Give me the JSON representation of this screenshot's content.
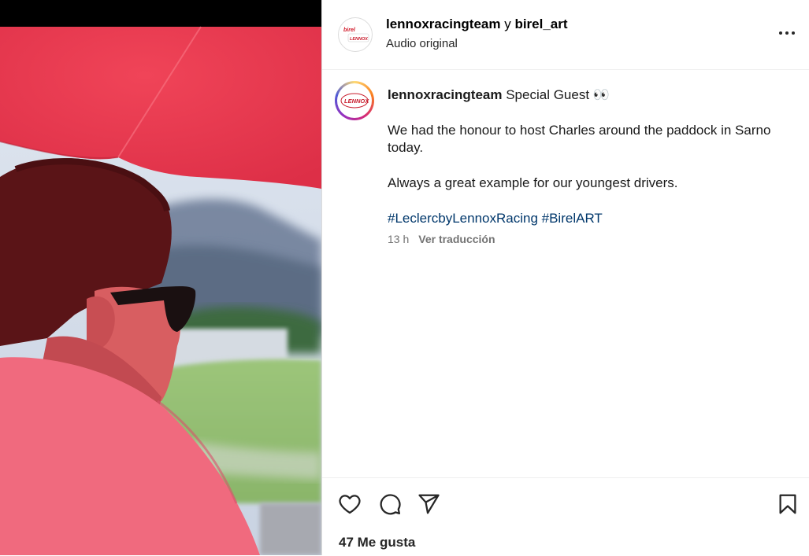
{
  "header": {
    "account_1": "lennoxracingteam",
    "joiner": " y ",
    "account_2": "birel_art",
    "subtitle": "Audio original",
    "more_icon": "more-horizontal-icon"
  },
  "caption": {
    "username": "lennoxracingteam",
    "first_line": " Special Guest 👀",
    "paragraph_1": "We had the honour to host Charles around the paddock in Sarno today.",
    "paragraph_2": "Always a great example for our youngest drivers.",
    "hashtag_1": "#LeclercbyLennoxRacing",
    "hashtag_2": "#BirelART",
    "time_ago": "13 h",
    "translate_label": "Ver traducción"
  },
  "avatars": {
    "collab_text_1": "birel",
    "collab_text_2": "LENNOX",
    "profile_text": "LENNOX"
  },
  "actions": {
    "like_icon": "heart-icon",
    "comment_icon": "comment-icon",
    "share_icon": "share-icon",
    "save_icon": "bookmark-icon",
    "likes_label": "47 Me gusta"
  },
  "colors": {
    "hashtag": "#00376b",
    "muted": "#737373",
    "umbrella": "#e8394f",
    "shirt": "#f06a7e"
  }
}
